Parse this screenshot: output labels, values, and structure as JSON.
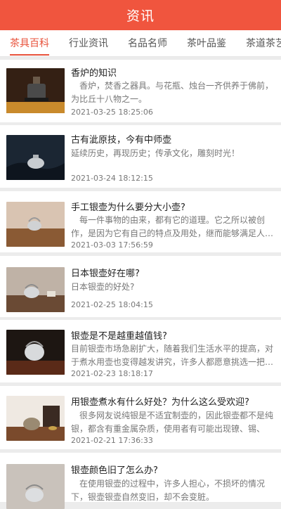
{
  "header": {
    "title": "资讯"
  },
  "tabs": [
    {
      "label": "茶具百科",
      "active": true
    },
    {
      "label": "行业资讯",
      "active": false
    },
    {
      "label": "名品名师",
      "active": false
    },
    {
      "label": "茶叶品鉴",
      "active": false
    },
    {
      "label": "茶道茶艺",
      "active": false
    }
  ],
  "articles": [
    {
      "title": "香炉的知识",
      "summary": "　香炉，焚香之器具。与花瓶、烛台一齐供养于佛前，为比丘十八物之一。",
      "date": "2021-03-25 18:25:06"
    },
    {
      "title": "古有泚原技，今有中师壶",
      "summary": "延续历史，再现历史；传承文化，雕刻时光！",
      "date": "2021-03-24 18:12:15"
    },
    {
      "title": "手工银壶为什么要分大小壶?",
      "summary": "　每一件事物的由来，都有它的道理。它之所以被创作，是因为它有自己的特点及用处，继而能够满足人们的需求。",
      "date": "2021-03-03 17:56:59"
    },
    {
      "title": "日本银壶好在哪?",
      "summary": "日本银壶的好处?",
      "date": "2021-02-25 18:04:15"
    },
    {
      "title": "银壶是不是越重越值钱?",
      "summary": "目前银壶市场急剧扩大，随着我们生活水平的提高，对于煮水用壶也变得越发讲究，许多人都愿意挑选一把银壶。",
      "date": "2021-02-23 18:18:17"
    },
    {
      "title": "用银壶煮水有什么好处？为什么这么受欢迎?",
      "summary": "　很多网友说纯银是不适宜制壶的，因此银壶都不是纯银，都含有重金属杂质，使用者有可能出现镣、锡、",
      "date": "2021-02-21 17:36:33"
    },
    {
      "title": "银壶颜色旧了怎么办?",
      "summary": "　在使用银壶的过程中，许多人担心，不损坏的情况下，银壶银壶自然变旧，却不会变脏。",
      "date": ""
    }
  ]
}
